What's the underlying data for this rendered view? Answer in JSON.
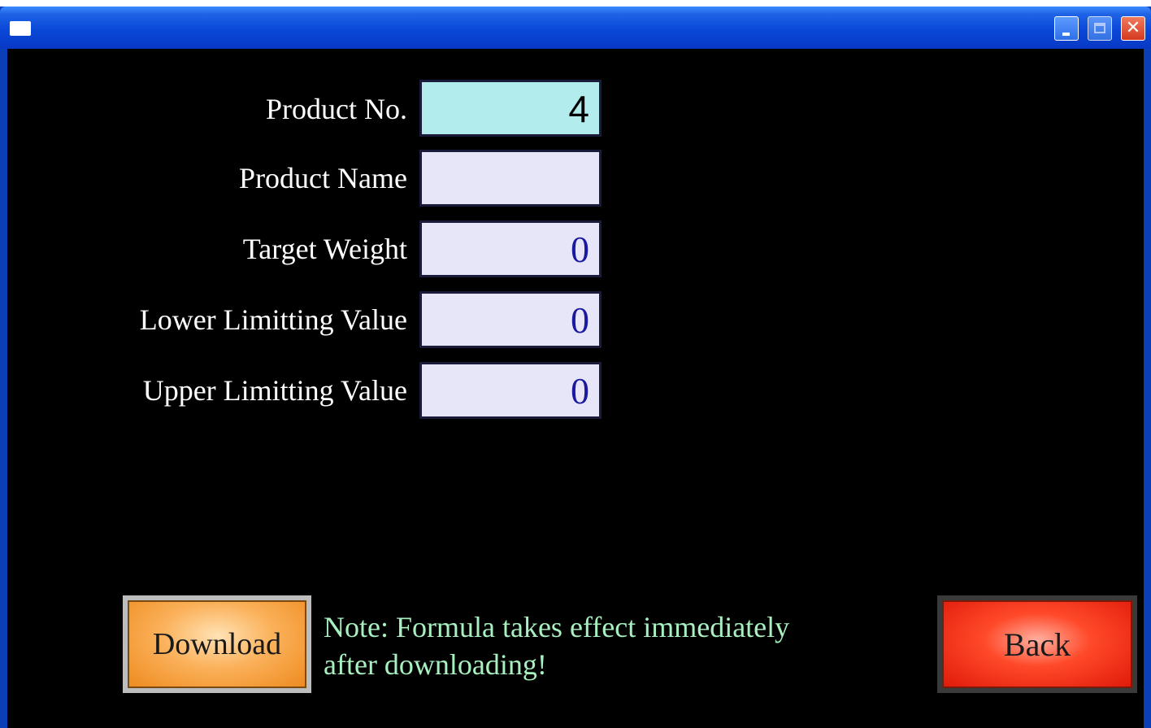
{
  "window": {
    "controls": {
      "minimize_icon": "minimize-icon",
      "maximize_icon": "maximize-icon",
      "close_symbol": "✕"
    }
  },
  "form": {
    "product_no": {
      "label": "Product No.",
      "value": "4"
    },
    "product_name": {
      "label": "Product Name",
      "value": ""
    },
    "target_weight": {
      "label": "Target Weight",
      "value": "0"
    },
    "lower_limit": {
      "label": "Lower Limitting Value",
      "value": "0"
    },
    "upper_limit": {
      "label": "Upper Limitting Value",
      "value": "0"
    }
  },
  "actions": {
    "download_label": "Download",
    "back_label": "Back"
  },
  "note": {
    "line1": "Note: Formula takes effect immediately",
    "line2": "after downloading!"
  },
  "colors": {
    "background": "#000000",
    "active_field": "#b3ecec",
    "field": "#e6e6f8",
    "field_text": "#1a1aa0",
    "note_text": "#a8f0c0",
    "download_button": "#f3a23f",
    "back_button": "#ff3a1f"
  }
}
